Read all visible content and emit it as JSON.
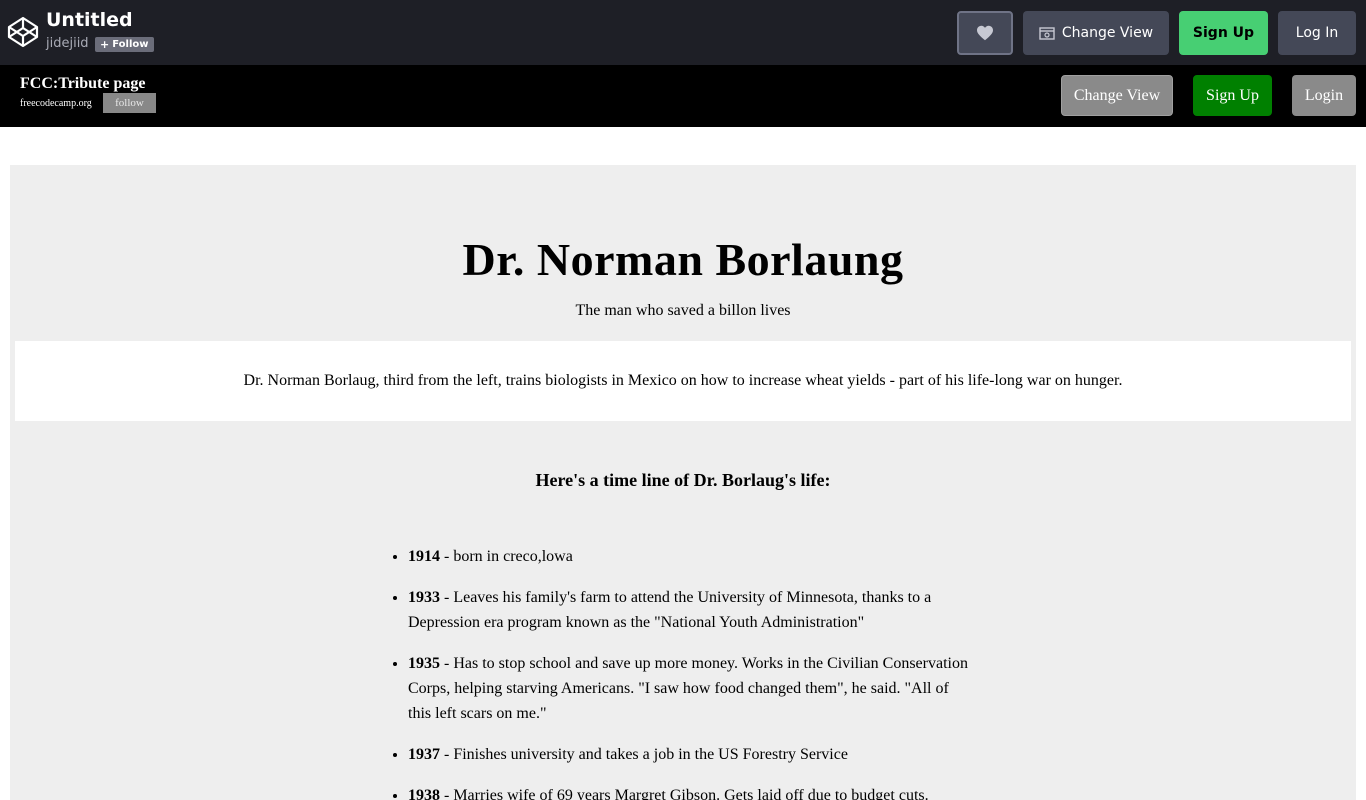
{
  "codepen": {
    "title": "Untitled",
    "username": "jidejiid",
    "follow_label": "Follow",
    "change_view_label": "Change View",
    "signup_label": "Sign Up",
    "login_label": "Log In"
  },
  "pen_header": {
    "title": "FCC:Tribute page",
    "username": "freecodecamp.org",
    "follow_label": "follow",
    "change_view_label": "Change View",
    "signup_label": "Sign Up",
    "login_label": "Login"
  },
  "tribute": {
    "title": "Dr. Norman Borlaung",
    "subtitle": "The man who saved a billon lives",
    "caption": "Dr. Norman Borlaug, third from the left, trains biologists in Mexico on how to increase wheat yields - part of his life-long war on hunger.",
    "timeline_heading": "Here's a time line of Dr. Borlaug's life:",
    "timeline": [
      {
        "year": "1914",
        "text": " - born in creco,lowa"
      },
      {
        "year": "1933",
        "text": " - Leaves his family's farm to attend the University of Minnesota, thanks to a Depression era program known as the \"National Youth Administration\""
      },
      {
        "year": "1935",
        "text": " - Has to stop school and save up more money. Works in the Civilian Conservation Corps, helping starving Americans. \"I saw how food changed them\", he said. \"All of this left scars on me.\""
      },
      {
        "year": "1937",
        "text": " - Finishes university and takes a job in the US Forestry Service"
      },
      {
        "year": "1938",
        "text": " - Marries wife of 69 years Margret Gibson. Gets laid off due to budget cuts."
      }
    ]
  },
  "colors": {
    "codepen_bar": "#1e1f26",
    "codepen_signup": "#47cf73",
    "pen_bar": "#000000",
    "pen_signup": "#008000",
    "main_bg": "#eeeeee"
  }
}
